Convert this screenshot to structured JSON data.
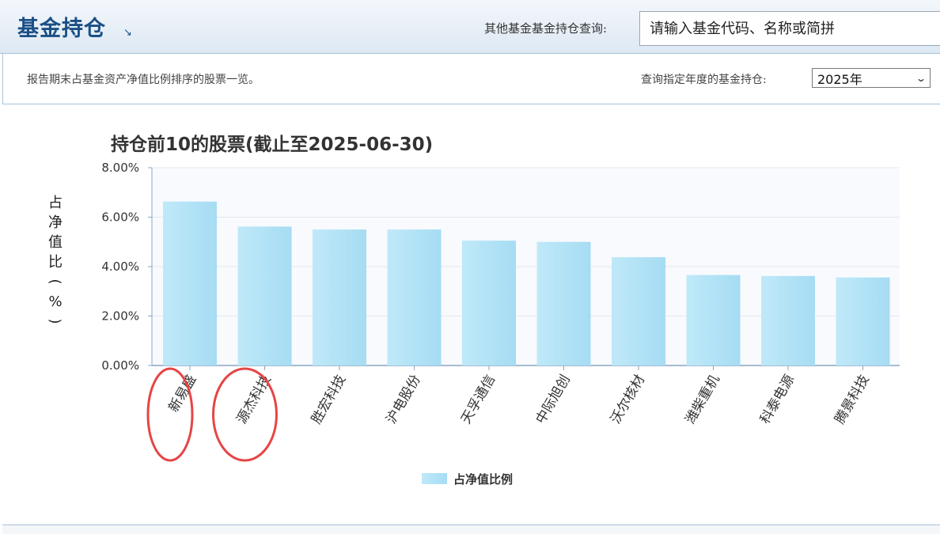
{
  "header": {
    "title": "基金持仓",
    "arrow_icon": "↘",
    "other_query_label": "其他基金基金持仓查询:",
    "search_placeholder": "请输入基金代码、名称或简拼"
  },
  "subheader": {
    "description": "报告期末占基金资产净值比例排序的股票一览。",
    "year_label": "查询指定年度的基金持仓:",
    "year_selected": "2025年"
  },
  "colors": {
    "bar_top": "#c6ecfa",
    "bar_bottom": "#a9def4",
    "annotation": "#e64545",
    "header_text": "#1a4f86"
  },
  "chart_data": {
    "type": "bar",
    "title": "持仓前10的股票(截止至2025-06-30)",
    "ylabel": "占净值比(%)",
    "xlabel": "",
    "ylim": [
      0,
      8
    ],
    "yticks": [
      "0.00%",
      "2.00%",
      "4.00%",
      "6.00%",
      "8.00%"
    ],
    "categories": [
      "新易盛",
      "源杰科技",
      "胜宏科技",
      "沪电股份",
      "天孚通信",
      "中际旭创",
      "沃尔核材",
      "潍柴重机",
      "科泰电源",
      "腾景科技"
    ],
    "series": [
      {
        "name": "占净值比例",
        "values": [
          6.63,
          5.62,
          5.5,
          5.5,
          5.05,
          5.0,
          4.38,
          3.66,
          3.62,
          3.56
        ]
      }
    ],
    "legend": "bottom-center",
    "grid": true,
    "annotations": [
      "新易盛",
      "源杰科技"
    ]
  }
}
